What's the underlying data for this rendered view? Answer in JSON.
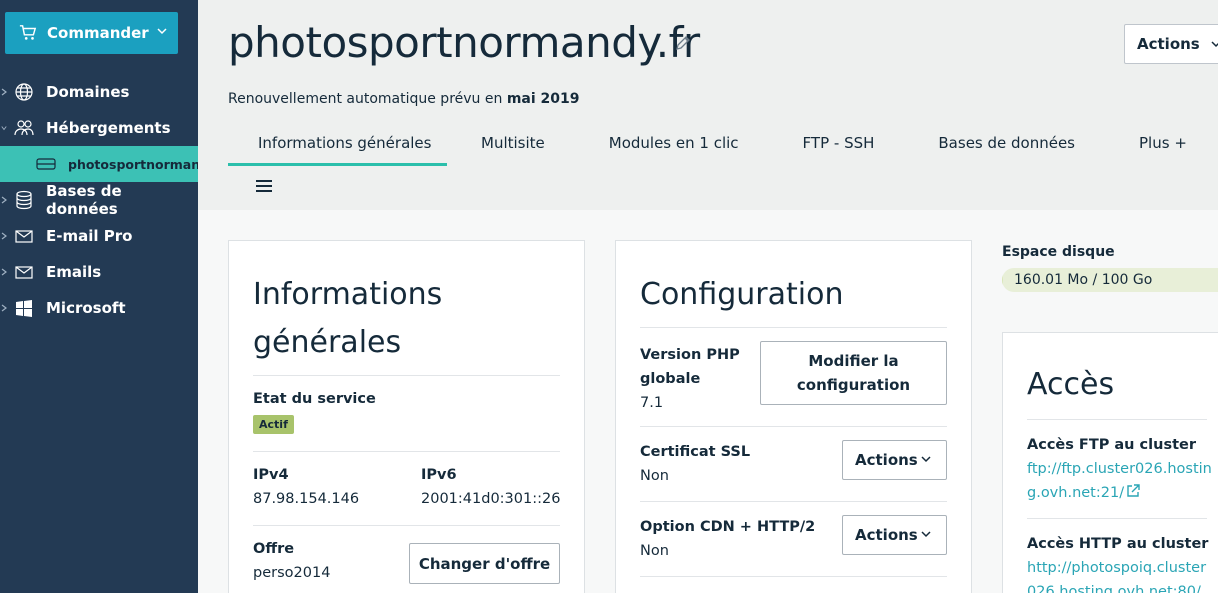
{
  "sidebar": {
    "order_label": "Commander",
    "items": [
      {
        "label": "Domaines",
        "icon": "globe-icon"
      },
      {
        "label": "Hébergements",
        "icon": "users-icon"
      },
      {
        "label": "photosportnormand",
        "icon": "server-icon"
      },
      {
        "label": "Bases de données",
        "icon": "database-icon"
      },
      {
        "label": "E-mail Pro",
        "icon": "mail-icon"
      },
      {
        "label": "Emails",
        "icon": "mail-icon"
      },
      {
        "label": "Microsoft",
        "icon": "windows-icon"
      }
    ]
  },
  "header": {
    "title": "photosportnormandy.fr",
    "renew_text": "Renouvellement automatique prévu en",
    "renew_date": "mai 2019",
    "actions_label": "Actions",
    "tabs": [
      "Informations générales",
      "Multisite",
      "Modules en 1 clic",
      "FTP - SSH",
      "Bases de données",
      "Plus +"
    ]
  },
  "info_card": {
    "title_line1": "Informations",
    "title_line2": "générales",
    "state_label": "Etat du service",
    "state_value": "Actif",
    "ipv4_label": "IPv4",
    "ipv4_value": "87.98.154.146",
    "ipv6_label": "IPv6",
    "ipv6_value": "2001:41d0:301::26",
    "offer_label": "Offre",
    "offer_value": "perso2014",
    "change_offer_label": "Changer d'offre"
  },
  "config_card": {
    "title": "Configuration",
    "php_label_line1": "Version PHP",
    "php_label_line2": "globale",
    "php_value": "7.1",
    "modify_line1": "Modifier la",
    "modify_line2": "configuration",
    "ssl_label": "Certificat SSL",
    "ssl_value": "Non",
    "cdn_label": "Option CDN + HTTP/2",
    "cdn_value": "Non",
    "actions_label": "Actions"
  },
  "disk": {
    "label": "Espace disque",
    "value_text": "160.01 Mo / 100 Go",
    "usage_fraction": 0.0016
  },
  "access_card": {
    "title": "Accès",
    "ftp_label": "Accès FTP au cluster",
    "ftp_link_line1": "ftp://ftp.cluster026.hostin",
    "ftp_link_line2": "g.ovh.net:21/",
    "http_label": "Accès HTTP au cluster",
    "http_link_line1": "http://photospoiq.cluster",
    "http_link_line2": "026.hosting.ovh.net:80/"
  },
  "colors": {
    "sidebar_bg": "#233a54",
    "accent": "#1ba0c0",
    "active_item": "#3cc1b5",
    "badge_green": "#a8c36b",
    "link": "#2aa5b5"
  }
}
